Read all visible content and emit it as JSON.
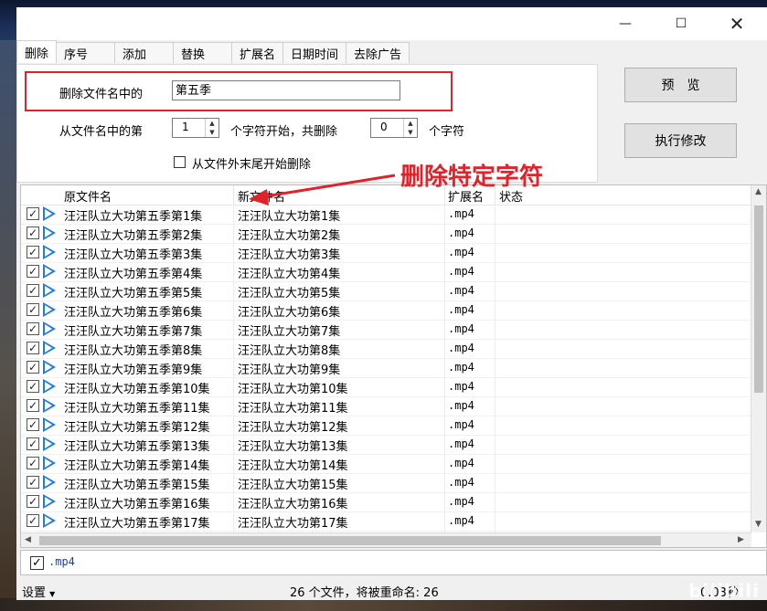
{
  "window": {
    "minimize_icon": "minimize-icon",
    "maximize_icon": "maximize-icon",
    "close_icon": "close-icon"
  },
  "tabs": [
    "删除",
    "序号",
    "添加",
    "替换",
    "扩展名",
    "日期时间",
    "去除广告"
  ],
  "active_tab": "删除",
  "delete_panel": {
    "remove_label": "删除文件名中的",
    "remove_value": "第五季",
    "from_label": "从文件名中的第",
    "start_value": "1",
    "mid_label": "个字符开始，共删除",
    "count_value": "0",
    "end_label": "个字符",
    "from_end_label": "从文件外末尾开始删除"
  },
  "buttons": {
    "preview": "预　览",
    "execute": "执行修改"
  },
  "annotation": {
    "text": "删除特定字符",
    "color": "#e0222a"
  },
  "grid": {
    "headers": {
      "original": "原文件名",
      "new": "新文件名",
      "ext": "扩展名",
      "status": "状态"
    },
    "rows": [
      {
        "original": "汪汪队立大功第五季第1集",
        "new": "汪汪队立大功第1集",
        "ext": ".mp4"
      },
      {
        "original": "汪汪队立大功第五季第2集",
        "new": "汪汪队立大功第2集",
        "ext": ".mp4"
      },
      {
        "original": "汪汪队立大功第五季第3集",
        "new": "汪汪队立大功第3集",
        "ext": ".mp4"
      },
      {
        "original": "汪汪队立大功第五季第4集",
        "new": "汪汪队立大功第4集",
        "ext": ".mp4"
      },
      {
        "original": "汪汪队立大功第五季第5集",
        "new": "汪汪队立大功第5集",
        "ext": ".mp4"
      },
      {
        "original": "汪汪队立大功第五季第6集",
        "new": "汪汪队立大功第6集",
        "ext": ".mp4"
      },
      {
        "original": "汪汪队立大功第五季第7集",
        "new": "汪汪队立大功第7集",
        "ext": ".mp4"
      },
      {
        "original": "汪汪队立大功第五季第8集",
        "new": "汪汪队立大功第8集",
        "ext": ".mp4"
      },
      {
        "original": "汪汪队立大功第五季第9集",
        "new": "汪汪队立大功第9集",
        "ext": ".mp4"
      },
      {
        "original": "汪汪队立大功第五季第10集",
        "new": "汪汪队立大功第10集",
        "ext": ".mp4"
      },
      {
        "original": "汪汪队立大功第五季第11集",
        "new": "汪汪队立大功第11集",
        "ext": ".mp4"
      },
      {
        "original": "汪汪队立大功第五季第12集",
        "new": "汪汪队立大功第12集",
        "ext": ".mp4"
      },
      {
        "original": "汪汪队立大功第五季第13集",
        "new": "汪汪队立大功第13集",
        "ext": ".mp4"
      },
      {
        "original": "汪汪队立大功第五季第14集",
        "new": "汪汪队立大功第14集",
        "ext": ".mp4"
      },
      {
        "original": "汪汪队立大功第五季第15集",
        "new": "汪汪队立大功第15集",
        "ext": ".mp4"
      },
      {
        "original": "汪汪队立大功第五季第16集",
        "new": "汪汪队立大功第16集",
        "ext": ".mp4"
      },
      {
        "original": "汪汪队立大功第五季第17集",
        "new": "汪汪队立大功第17集",
        "ext": ".mp4"
      }
    ]
  },
  "ext_filter": ".mp4",
  "status_bar": {
    "settings": "设置",
    "summary": "26 个文件，将被重命名: 26",
    "time": "0.03秒"
  },
  "watermark": "bilibili 追踪点"
}
